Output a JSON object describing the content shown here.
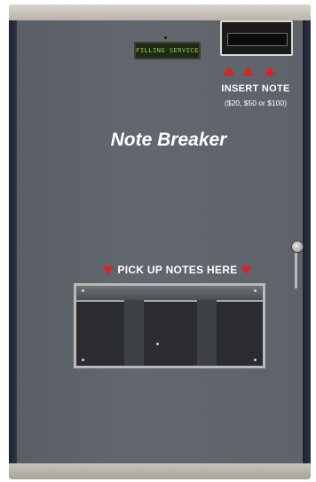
{
  "machine": {
    "display_text": "FILLING SERVICE",
    "insert_label": "INSERT NOTE",
    "insert_denominations": "($20, $50 or $100)",
    "brand": "Note Breaker",
    "pickup_label": "PICK UP NOTES HERE"
  },
  "colors": {
    "panel": "#5f646b",
    "accent_arrow": "#e02020",
    "lcd_text": "#8fd04a",
    "side_trim": "#1c2230"
  },
  "icons": {
    "up_arrow": "red-up-arrow",
    "down_arrow": "red-down-arrow",
    "lock": "key-lock"
  }
}
